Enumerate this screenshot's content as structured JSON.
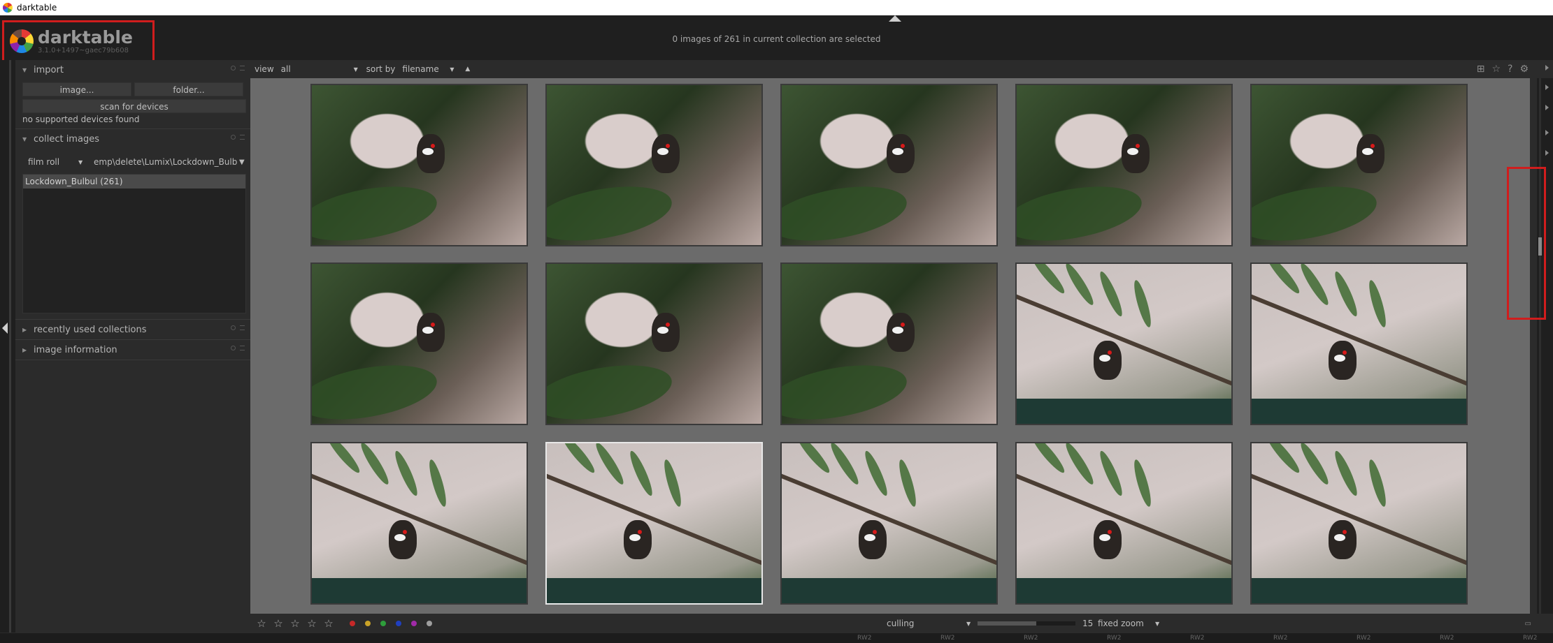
{
  "window": {
    "title": "darktable"
  },
  "header": {
    "logo_name": "darktable",
    "logo_version": "3.1.0+1497~gaec79b608",
    "selection_status": "0 images of 261 in current collection are selected"
  },
  "left_panel": {
    "import": {
      "title": "import",
      "image_button": "image...",
      "folder_button": "folder...",
      "scan_button": "scan for devices",
      "devices_status": "no supported devices found"
    },
    "collect": {
      "title": "collect images",
      "rule_property": "film roll",
      "rule_value": "emp\\delete\\Lumix\\Lockdown_Bulbul",
      "list_items": [
        "Lockdown_Bulbul (261)"
      ]
    },
    "recent_collections": {
      "title": "recently used collections"
    },
    "image_information": {
      "title": "image information"
    }
  },
  "top_toolbar": {
    "view_label": "view",
    "view_value": "all",
    "sort_label": "sort by",
    "sort_value": "filename"
  },
  "grid": {
    "selected_index": 11,
    "thumbnails": [
      {
        "style": "dark"
      },
      {
        "style": "dark"
      },
      {
        "style": "dark"
      },
      {
        "style": "dark"
      },
      {
        "style": "dark"
      },
      {
        "style": "dark"
      },
      {
        "style": "dark"
      },
      {
        "style": "dark"
      },
      {
        "style": "light"
      },
      {
        "style": "light"
      },
      {
        "style": "light"
      },
      {
        "style": "light"
      },
      {
        "style": "light"
      },
      {
        "style": "light"
      },
      {
        "style": "light"
      }
    ]
  },
  "bottom_toolbar": {
    "stars": [
      "☆",
      "☆",
      "☆",
      "☆",
      "☆"
    ],
    "color_labels": [
      "#c62828",
      "#c9a227",
      "#2e9e3b",
      "#1f3fbf",
      "#a02aa8",
      "#9e9e9e"
    ],
    "layout_mode": "culling",
    "zoom_count": "15",
    "zoom_mode": "fixed zoom"
  },
  "filmstrip": {
    "label": "RW2"
  },
  "colors": {
    "highlight_box": "#d01d1d",
    "grid_background": "#6b6b6b",
    "panel_background": "#2b2b2b"
  }
}
